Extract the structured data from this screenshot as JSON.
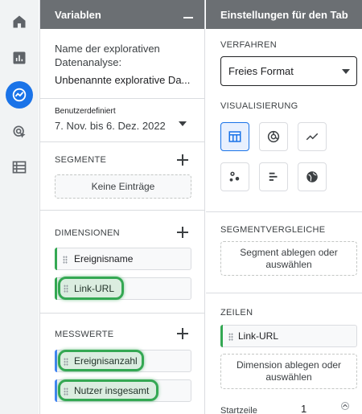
{
  "rail": {
    "items": [
      {
        "icon": "home-icon"
      },
      {
        "icon": "reports-icon"
      },
      {
        "icon": "explore-icon",
        "active": true
      },
      {
        "icon": "advertising-icon"
      },
      {
        "icon": "configure-icon"
      }
    ]
  },
  "variables": {
    "title": "Variablen",
    "name_label": "Name der explorativen Datenanalyse:",
    "name_value": "Unbenannte explorative Da...",
    "date_badge": "Benutzerdefiniert",
    "date_range": "7. Nov. bis 6. Dez. 2022",
    "segments_label": "SEGMENTE",
    "segments_empty": "Keine Einträge",
    "dimensions_label": "DIMENSIONEN",
    "dimensions": [
      "Ereignisname",
      "Link-URL"
    ],
    "metrics_label": "MESSWERTE",
    "metrics": [
      "Ereignisanzahl",
      "Nutzer insgesamt"
    ]
  },
  "tab_settings": {
    "title": "Einstellungen für den Tab",
    "technique_label": "VERFAHREN",
    "technique_value": "Freies Format",
    "visualization_label": "VISUALISIERUNG",
    "visualization_icons": [
      "table-icon",
      "donut-chart-icon",
      "line-chart-icon",
      "scatter-plot-icon",
      "bar-chart-icon",
      "geo-map-icon"
    ],
    "segment_comparisons_label": "SEGMENTVERGLEICHE",
    "segment_drop": "Segment ablegen oder auswählen",
    "rows_label": "ZEILEN",
    "rows": [
      "Link-URL"
    ],
    "dimension_drop": "Dimension ablegen oder auswählen",
    "start_row_label": "Startzeile",
    "start_row_value": "1"
  },
  "colors": {
    "accent": "#1a73e8",
    "dimension_bar": "#34a853",
    "metric_bar": "#4285f4",
    "highlight": "#34a853"
  }
}
